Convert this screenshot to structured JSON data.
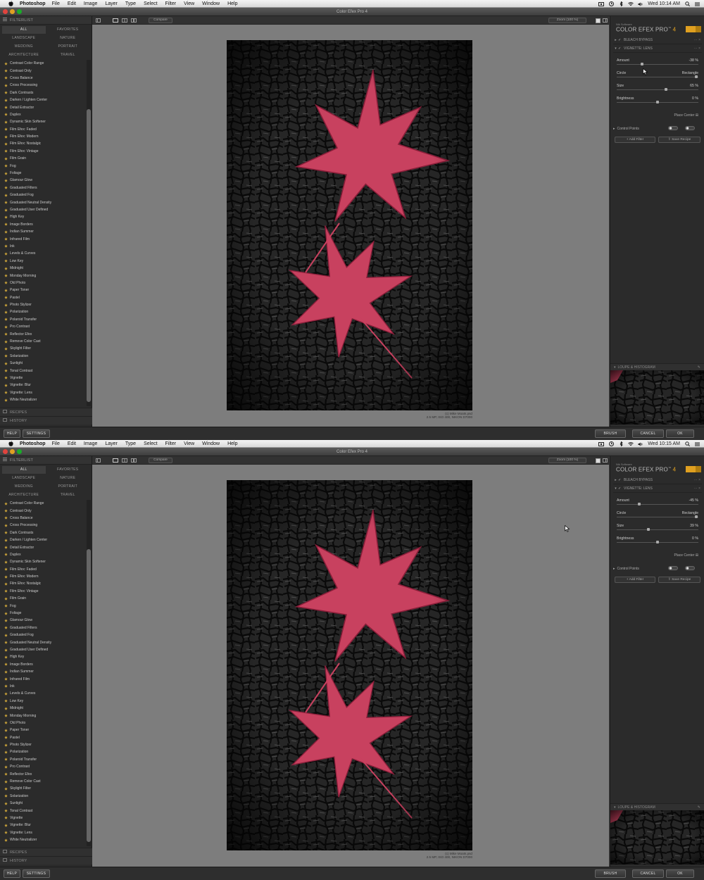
{
  "colors": {
    "accent": "#e0a020",
    "star": "#c9a23a",
    "leaf": "#c8415f"
  },
  "menubar": {
    "app": "Photoshop",
    "items": [
      "File",
      "Edit",
      "Image",
      "Layer",
      "Type",
      "Select",
      "Filter",
      "View",
      "Window",
      "Help"
    ]
  },
  "window": {
    "title": "Color Efex Pro 4"
  },
  "left_panel": {
    "header": "FILTERLIST",
    "categories": [
      "ALL",
      "FAVORITES",
      "LANDSCAPE",
      "NATURE",
      "WEDDING",
      "PORTRAIT",
      "ARCHITECTURE",
      "TRAVEL"
    ],
    "filters": [
      "Contrast Color Range",
      "Contrast Only",
      "Cross Balance",
      "Cross Processing",
      "Dark Contrasts",
      "Darken / Lighten Center",
      "Detail Extractor",
      "Duplex",
      "Dynamic Skin Softener",
      "Film Efex: Faded",
      "Film Efex: Modern",
      "Film Efex: Nostalgic",
      "Film Efex: Vintage",
      "Film Grain",
      "Fog",
      "Foliage",
      "Glamour Glow",
      "Graduated Filters",
      "Graduated Fog",
      "Graduated Neutral Density",
      "Graduated User Defined",
      "High Key",
      "Image Borders",
      "Indian Summer",
      "Infrared Film",
      "Ink",
      "Levels & Curves",
      "Low Key",
      "Midnight",
      "Monday Morning",
      "Old Photo",
      "Paper Toner",
      "Pastel",
      "Photo Stylizer",
      "Polarization",
      "Polaroid Transfer",
      "Pro Contrast",
      "Reflector Efex",
      "Remove Color Cast",
      "Skylight Filter",
      "Solarization",
      "Sunlight",
      "Tonal Contrast",
      "Vignette",
      "Vignette: Blur",
      "Vignette: Lens",
      "White Neutralizer"
    ],
    "recipes": "RECIPES",
    "history": "HISTORY"
  },
  "toolbar": {
    "compare": "Compare",
    "zoom": "Zoom (100 %)"
  },
  "photo": {
    "credit_line1": "(c) Mike Moats.psd",
    "credit_line2": "2.5 MP, ISO 400, NIKON D7000"
  },
  "right_panel": {
    "brand_small": "Nik Software",
    "brand_name": "COLOR EFEX PRO",
    "brand_version": "4",
    "filter1": "BLEACH BYPASS",
    "filter2": "VIGNETTE: LENS",
    "amount_label": "Amount",
    "circle_label": "Circle",
    "rectangle_label": "Rectangle",
    "size_label": "Size",
    "brightness_label": "Brightness",
    "place_center": "Place Center",
    "control_points": "Control Points",
    "add_filter": "Add Filter",
    "save_recipe": "Save Recipe",
    "loupe": "LOUPE & HISTOGRAM"
  },
  "bottom": {
    "help": "HELP",
    "settings": "SETTINGS",
    "brush": "BRUSH",
    "cancel": "CANCEL",
    "ok": "OK"
  },
  "frames": [
    {
      "time": "Wed 10:14 AM",
      "amount": "-38 %",
      "amount_frac": 0.31,
      "shape_frac": 0.97,
      "size": "65 %",
      "size_frac": 0.6,
      "brightness": "0 %",
      "brightness_frac": 0.5
    },
    {
      "time": "Wed 10:15 AM",
      "amount": "-45 %",
      "amount_frac": 0.28,
      "shape_frac": 0.97,
      "size": "39 %",
      "size_frac": 0.39,
      "brightness": "0 %",
      "brightness_frac": 0.5
    }
  ]
}
